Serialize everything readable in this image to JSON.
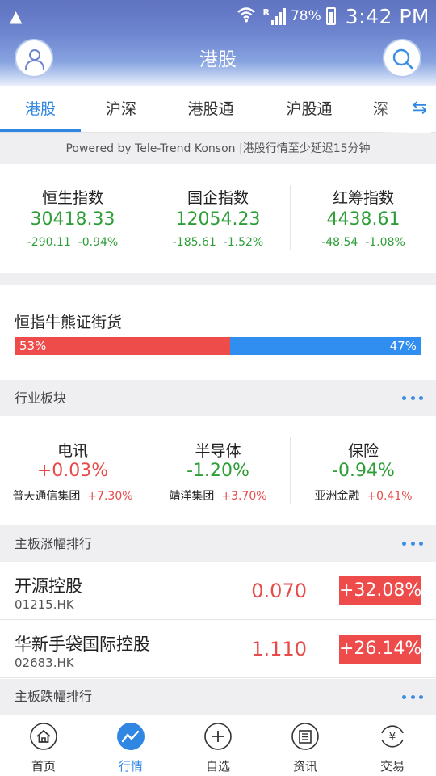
{
  "status_bar": {
    "signal_prefix": "R",
    "battery": "78%",
    "time": "3:42 PM"
  },
  "header": {
    "title": "港股"
  },
  "tabs": [
    {
      "label": "港股",
      "active": true
    },
    {
      "label": "沪深"
    },
    {
      "label": "港股通"
    },
    {
      "label": "沪股通"
    },
    {
      "label": "深"
    }
  ],
  "notice": "Powered by Tele-Trend Konson |港股行情至少延迟15分钟",
  "indices": [
    {
      "name": "恒生指数",
      "value": "30418.33",
      "change": "-290.11",
      "percent": "-0.94%"
    },
    {
      "name": "国企指数",
      "value": "12054.23",
      "change": "-185.61",
      "percent": "-1.52%"
    },
    {
      "name": "红筹指数",
      "value": "4438.61",
      "change": "-48.54",
      "percent": "-1.08%"
    }
  ],
  "bull_bear": {
    "label": "恒指牛熊证街货",
    "bull_percent": 53,
    "bear_percent": 47,
    "bull_label": "53%",
    "bear_label": "47%"
  },
  "sections": {
    "industry": "行业板块",
    "gainers": "主板涨幅排行",
    "losers": "主板跌幅排行"
  },
  "sectors": [
    {
      "name": "电讯",
      "percent": "+0.03%",
      "direction": "up",
      "leader": "普天通信集团",
      "leader_change": "+7.30%"
    },
    {
      "name": "半导体",
      "percent": "-1.20%",
      "direction": "down",
      "leader": "靖洋集团",
      "leader_change": "+3.70%"
    },
    {
      "name": "保险",
      "percent": "-0.94%",
      "direction": "down",
      "leader": "亚洲金融",
      "leader_change": "+0.41%"
    }
  ],
  "gainers": [
    {
      "name": "开源控股",
      "code": "01215.HK",
      "price": "0.070",
      "change": "+32.08%"
    },
    {
      "name": "华新手袋国际控股",
      "code": "02683.HK",
      "price": "1.110",
      "change": "+26.14%"
    }
  ],
  "bottom_nav": [
    {
      "label": "首页",
      "icon": "home-icon"
    },
    {
      "label": "行情",
      "icon": "market-chart-icon",
      "active": true
    },
    {
      "label": "自选",
      "icon": "add-favorite-icon"
    },
    {
      "label": "资讯",
      "icon": "news-icon"
    },
    {
      "label": "交易",
      "icon": "trade-yuan-icon"
    }
  ],
  "colors": {
    "header": "#6d84cf",
    "accent": "#2f86e3",
    "up": "#e84a4a",
    "down": "#2e9e38",
    "bear_bar": "#2f8ef0"
  }
}
